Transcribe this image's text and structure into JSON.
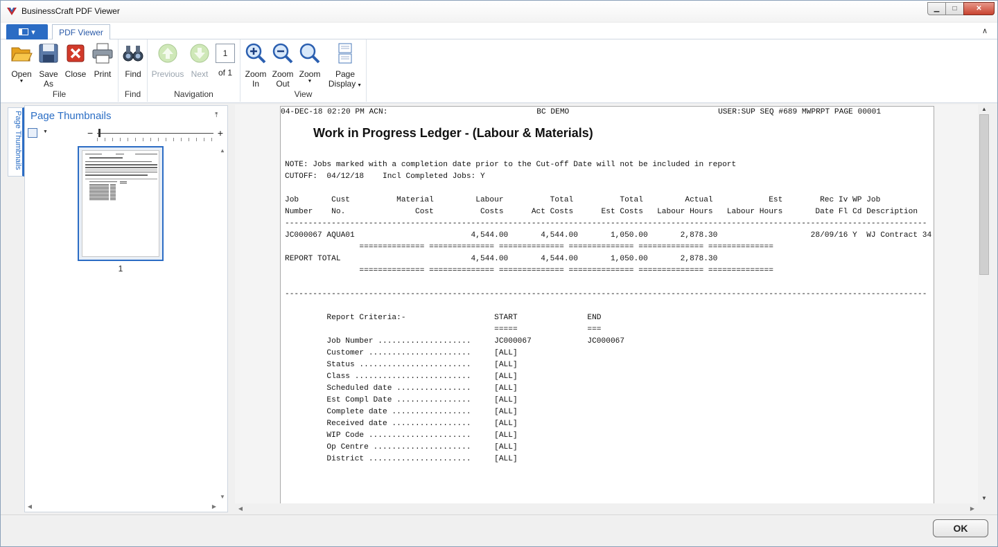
{
  "window": {
    "title": "BusinessCraft PDF Viewer",
    "accent": "#2b6cc4"
  },
  "tabs": {
    "active": "PDF Viewer"
  },
  "ribbon": {
    "file": {
      "label": "File",
      "open": "Open",
      "save_as_1": "Save",
      "save_as_2": "As",
      "close": "Close",
      "print": "Print"
    },
    "find": {
      "label": "Find",
      "find": "Find"
    },
    "navigation": {
      "label": "Navigation",
      "previous": "Previous",
      "next": "Next",
      "page_value": "1",
      "of_label": "of 1"
    },
    "view": {
      "label": "View",
      "zoom_in_1": "Zoom",
      "zoom_in_2": "In",
      "zoom_out_1": "Zoom",
      "zoom_out_2": "Out",
      "zoom": "Zoom",
      "page_display_1": "Page",
      "page_display_2": "Display"
    }
  },
  "thumbnails": {
    "strip_tab": "Page Thumbnails",
    "title": "Page Thumbnails",
    "page_label": "1"
  },
  "document": {
    "header": "04-DEC-18 02:20 PM ACN:                                BC DEMO                                USER:SUP SEQ #689 MWPRPT PAGE 00001",
    "title": "Work in Progress Ledger - (Labour & Materials)",
    "body": "NOTE: Jobs marked with a completion date prior to the Cut-off Date will not be included in report\nCUTOFF:  04/12/18    Incl Completed Jobs: Y\n\nJob       Cust          Material         Labour          Total          Total         Actual            Est        Rec Iv WP Job\nNumber    No.               Cost          Costs      Act Costs      Est Costs   Labour Hours   Labour Hours       Date Fl Cd Description\n------------------------------------------------------------------------------------------------------------------------------------------\nJC000067 AQUA01                         4,544.00       4,544.00       1,050.00       2,878.30                    28/09/16 Y  WJ Contract 34\n                ============== ============== ============== ============== ============== ==============\nREPORT TOTAL                            4,544.00       4,544.00       1,050.00       2,878.30\n                ============== ============== ============== ============== ============== ==============\n\n------------------------------------------------------------------------------------------------------------------------------------------\n\n         Report Criteria:-                   START               END\n                                             =====               ===\n         Job Number ....................     JC000067            JC000067\n         Customer ......................     [ALL]\n         Status ........................     [ALL]\n         Class .........................     [ALL]\n         Scheduled date ................     [ALL]\n         Est Compl Date ................     [ALL]\n         Complete date .................     [ALL]\n         Received date .................     [ALL]\n         WIP Code ......................     [ALL]\n         Op Centre .....................     [ALL]\n         District ......................     [ALL]"
  },
  "footer": {
    "ok": "OK"
  }
}
